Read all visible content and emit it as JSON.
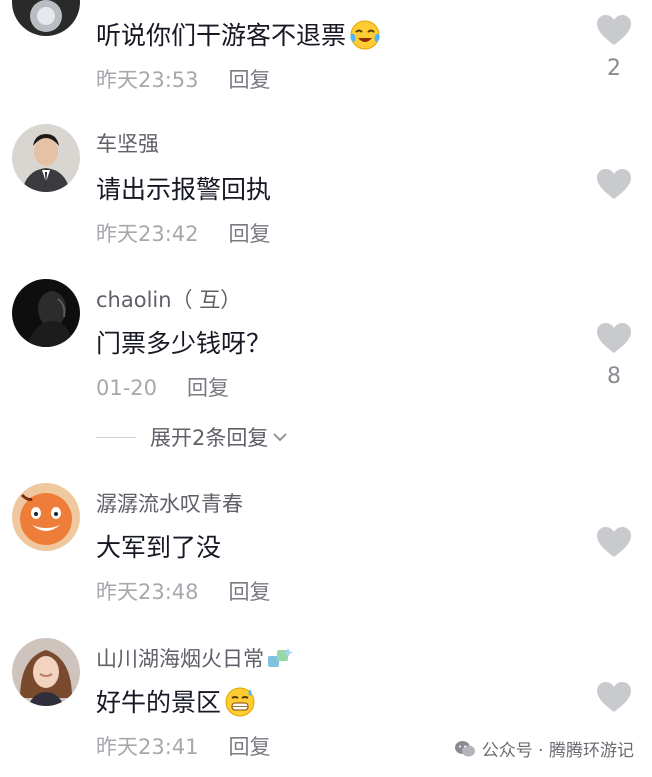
{
  "comments": [
    {
      "username": "",
      "text": "听说你们干游客不退票",
      "text_emoji": "crying-laughing-emoji",
      "time": "昨天23:53",
      "reply": "回复",
      "likes": "2"
    },
    {
      "username": "车坚强",
      "text": "请出示报警回执",
      "time": "昨天23:42",
      "reply": "回复",
      "likes": ""
    },
    {
      "username": "chaolin（ 互）",
      "text": "门票多少钱呀？",
      "time": "01-20",
      "reply": "回复",
      "likes": "8",
      "expand_label": "展开2条回复"
    },
    {
      "username": "潺潺流水叹青春",
      "text": "大军到了没",
      "time": "昨天23:48",
      "reply": "回复",
      "likes": ""
    },
    {
      "username": "山川湖海烟火日常",
      "username_emoji": "puzzle-sparkle-emoji",
      "text": "好牛的景区",
      "text_emoji": "grinning-sweat-emoji",
      "time": "昨天23:41",
      "reply": "回复",
      "likes": ""
    }
  ],
  "watermark": {
    "label": "公众号 · 腾腾环游记",
    "icon": "wechat-icon"
  },
  "colors": {
    "text": "#161823",
    "meta": "#a7a8ad",
    "username": "#5f6068",
    "heart": "#c9cacd"
  }
}
